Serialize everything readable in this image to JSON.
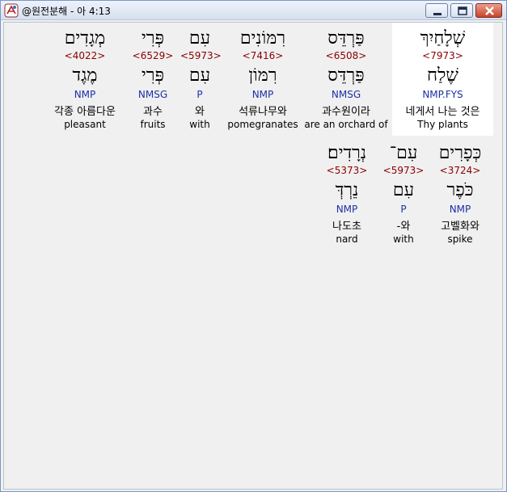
{
  "window": {
    "title": "@원전분해 - 아 4:13",
    "icon": "hebrew-app-icon",
    "controls": {
      "minimize": "minimize-icon",
      "maximize": "maximize-icon",
      "close": "close-icon"
    }
  },
  "colors": {
    "strong": "#8b0000",
    "morph": "#1f2fa8",
    "selected_bg": "#ffffff"
  },
  "rows": [
    {
      "words": [
        {
          "hebrew": "שְׁלָחַיִךְ",
          "strong": "<7973>",
          "root": "שֶׁלַח",
          "morph": "NMP.FYS",
          "korean": "네게서 나는 것은",
          "english": "Thy plants",
          "selected": true
        },
        {
          "hebrew": "פַּרְדֵּס",
          "strong": "<6508>",
          "root": "פַּרְדֵּס",
          "morph": "NMSG",
          "korean": "과수원이라",
          "english": "are an orchard of",
          "selected": false
        },
        {
          "hebrew": "רִמּוֹנִים",
          "strong": "<7416>",
          "root": "רִמּוֹן",
          "morph": "NMP",
          "korean": "석류나무와",
          "english": "pomegranates",
          "selected": false
        },
        {
          "hebrew": "עִם",
          "strong": "<5973>",
          "root": "עִם",
          "morph": "P",
          "korean": "와",
          "english": "with",
          "selected": false
        },
        {
          "hebrew": "פְּרִי",
          "strong": "<6529>",
          "root": "פְּרִי",
          "morph": "NMSG",
          "korean": "과수",
          "english": "fruits",
          "selected": false
        },
        {
          "hebrew": "מְגָדִים",
          "strong": "<4022>",
          "root": "מֶגֶד",
          "morph": "NMP",
          "korean": "각종 아름다운",
          "english": "pleasant",
          "selected": false
        }
      ]
    },
    {
      "words": [
        {
          "hebrew": "כְּפָרִים",
          "strong": "<3724>",
          "root": "כֹּפֶר",
          "morph": "NMP",
          "korean": "고벨화와",
          "english": "spike",
          "selected": false
        },
        {
          "hebrew": "עִם־",
          "strong": "<5973>",
          "root": "עִם",
          "morph": "P",
          "korean": "-와",
          "english": "with",
          "selected": false
        },
        {
          "hebrew": "נְרָדִים׃",
          "strong": "<5373>",
          "root": "נֵרְדְּ",
          "morph": "NMP",
          "korean": "나도초",
          "english": "nard",
          "selected": false
        }
      ]
    }
  ]
}
